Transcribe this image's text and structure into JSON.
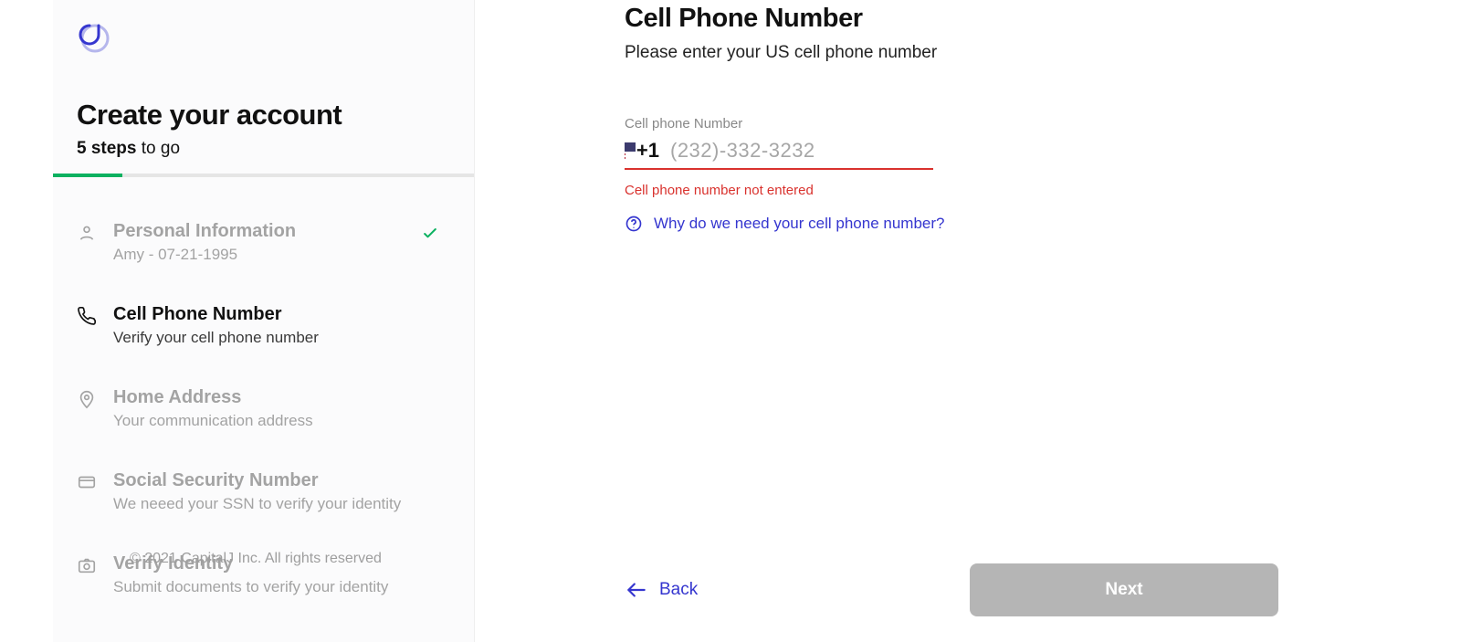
{
  "sidebar": {
    "title": "Create your account",
    "steps_count": "5 steps",
    "steps_togo": " to go",
    "copyright": "© 2021 CapitalJ Inc. All rights reserved",
    "steps": [
      {
        "label": "Personal Information",
        "sub": "Amy - 07-21-1995"
      },
      {
        "label": "Cell Phone Number",
        "sub": "Verify your cell phone number"
      },
      {
        "label": "Home Address",
        "sub": "Your communication address"
      },
      {
        "label": "Social Security Number",
        "sub": "We neeed your SSN to verify your identity"
      },
      {
        "label": "Verify Identity",
        "sub": "Submit documents to verify your identity"
      }
    ]
  },
  "main": {
    "title": "Cell Phone Number",
    "subtitle": "Please enter your US cell phone number",
    "field_label": "Cell phone Number",
    "prefix": "+1",
    "placeholder": "(232)-332-3232",
    "value": "",
    "error": "Cell phone number not entered",
    "why_link": "Why do we need your cell phone number?"
  },
  "nav": {
    "back": "Back",
    "next": "Next"
  }
}
